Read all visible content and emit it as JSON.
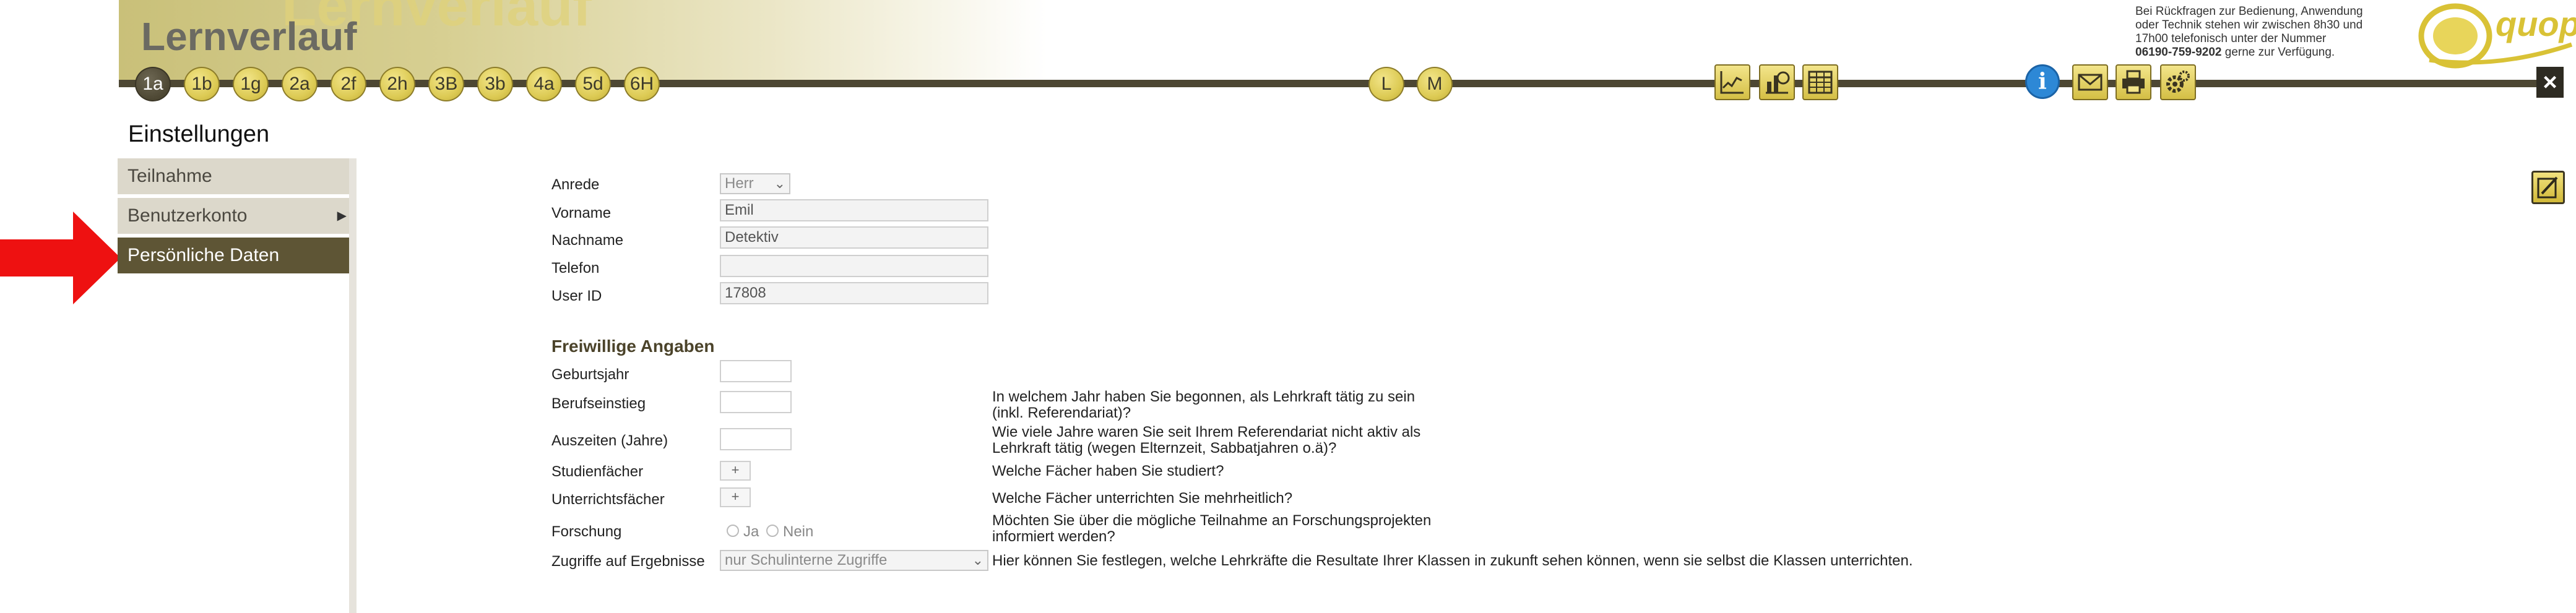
{
  "header": {
    "title": "Lernverlauf",
    "watermark": "Lernverlauf",
    "pills": [
      "1a",
      "1b",
      "1g",
      "2a",
      "2f",
      "2h",
      "3B",
      "3b",
      "4a",
      "5d",
      "6H"
    ],
    "active_pill": "1a",
    "mode_pills": [
      "L",
      "M"
    ],
    "tools_left": [
      "line-chart-icon",
      "bar-chart-icon",
      "table-grid-icon"
    ],
    "tools_right": [
      "info-icon",
      "mail-icon",
      "print-icon",
      "gear-icon"
    ],
    "contact": {
      "line1": "Bei Rückfragen zur Bedienung, Anwendung",
      "line2": "oder Technik stehen wir zwischen 8h30 und",
      "line3": "17h00 telefonisch unter der Nummer",
      "phone": "06190-759-9202",
      "line4_suffix": " gerne zur Verfügung."
    },
    "logo_text": "quop.",
    "close_label": "×",
    "colors": {
      "bar": "#4d4733",
      "pill": "#ddcb55",
      "accent_blue": "#2d88d6"
    }
  },
  "page_title": "Einstellungen",
  "sidebar": {
    "items": [
      {
        "label": "Teilnahme",
        "selected": false,
        "submenu": false
      },
      {
        "label": "Benutzerkonto",
        "selected": false,
        "submenu": true
      },
      {
        "label": "Persönliche Daten",
        "selected": true,
        "submenu": false
      }
    ],
    "submenu_arrow": "▶"
  },
  "form": {
    "anrede": {
      "label": "Anrede",
      "value": "Herr"
    },
    "vorname": {
      "label": "Vorname",
      "value": "Emil"
    },
    "nachname": {
      "label": "Nachname",
      "value": "Detektiv"
    },
    "telefon": {
      "label": "Telefon",
      "value": ""
    },
    "user_id": {
      "label": "User ID",
      "value": "17808"
    },
    "section_heading": "Freiwillige Angaben",
    "geburtsjahr": {
      "label": "Geburtsjahr",
      "value": ""
    },
    "berufseinstieg": {
      "label": "Berufseinstieg",
      "value": "",
      "hint1": "In welchem Jahr haben Sie begonnen, als Lehrkraft tätig zu sein",
      "hint2": "(inkl. Referendariat)?"
    },
    "auszeiten": {
      "label": "Auszeiten (Jahre)",
      "value": "",
      "hint1": "Wie viele Jahre waren Sie seit Ihrem Referendariat nicht aktiv als",
      "hint2": "Lehrkraft tätig (wegen Elternzeit, Sabbatjahren o.ä)?"
    },
    "studienfaecher": {
      "label": "Studienfächer",
      "button": "+",
      "hint": "Welche Fächer haben Sie studiert?"
    },
    "unterrichtsfaecher": {
      "label": "Unterrichtsfächer",
      "button": "+",
      "hint": "Welche Fächer unterrichten Sie mehrheitlich?"
    },
    "forschung": {
      "label": "Forschung",
      "yes": "Ja",
      "no": "Nein",
      "hint1": "Möchten Sie über die mögliche Teilnahme an Forschungsprojekten",
      "hint2": "informiert werden?"
    },
    "zugriffe": {
      "label": "Zugriffe auf Ergebnisse",
      "value": "nur Schulinterne Zugriffe",
      "hint": "Hier können Sie festlegen, welche Lehrkräfte die Resultate Ihrer Klassen in zukunft sehen können, wenn sie selbst die Klassen unterrichten."
    }
  }
}
